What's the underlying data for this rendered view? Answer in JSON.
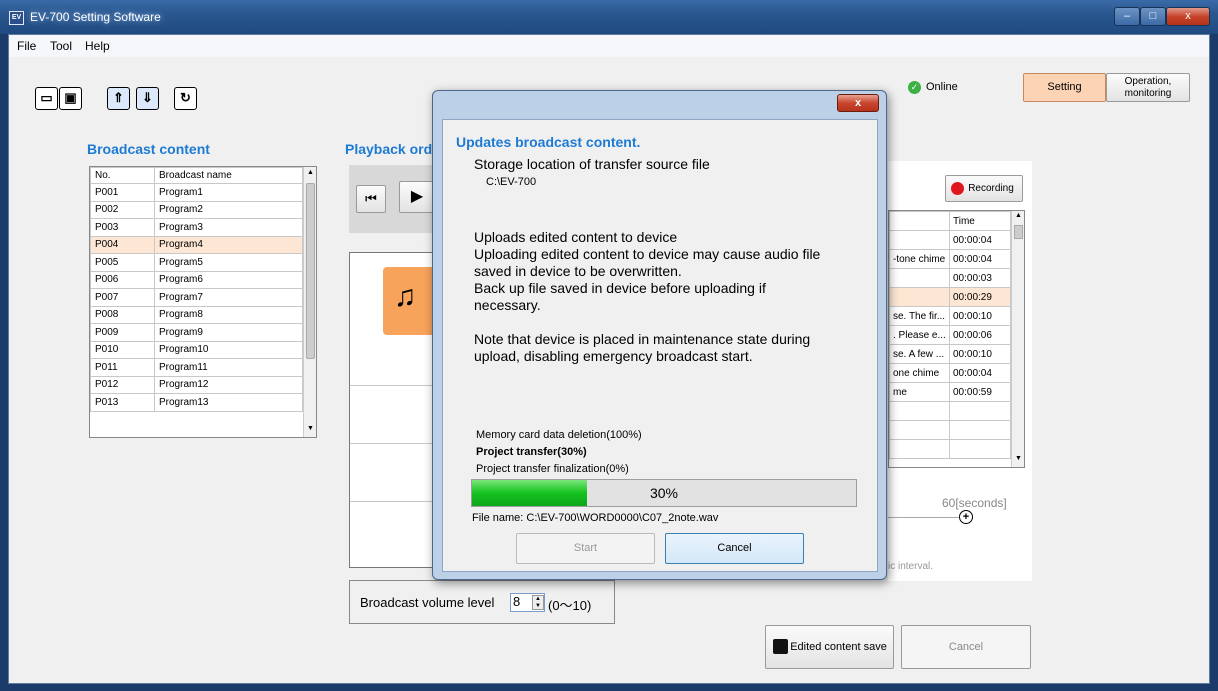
{
  "app": {
    "title": "EV-700 Setting Software",
    "icon_text": "EV"
  },
  "window_controls": {
    "min": "–",
    "max": "□",
    "close": "x"
  },
  "menu": [
    "File",
    "Tool",
    "Help"
  ],
  "toolbar": {
    "icons": [
      "open-icon",
      "save-icon",
      "upload-icon",
      "download-icon",
      "sync-icon"
    ]
  },
  "status": {
    "online_label": "Online",
    "online_color": "#3cb043"
  },
  "mode_buttons": {
    "setting": "Setting",
    "operation_line1": "Operation,",
    "operation_line2": "monitoring",
    "active_color": "#fcd3b4"
  },
  "broadcast_content": {
    "heading": "Broadcast content",
    "columns": [
      "No.",
      "Broadcast name"
    ],
    "rows": [
      [
        "P001",
        "Program1"
      ],
      [
        "P002",
        "Program2"
      ],
      [
        "P003",
        "Program3"
      ],
      [
        "P004",
        "Program4"
      ],
      [
        "P005",
        "Program5"
      ],
      [
        "P006",
        "Program6"
      ],
      [
        "P007",
        "Program7"
      ],
      [
        "P008",
        "Program8"
      ],
      [
        "P009",
        "Program9"
      ],
      [
        "P010",
        "Program10"
      ],
      [
        "P011",
        "Program11"
      ],
      [
        "P012",
        "Program12"
      ],
      [
        "P013",
        "Program13"
      ]
    ],
    "selected_index": 3
  },
  "playback": {
    "heading": "Playback ord",
    "prev_icon": "⏮",
    "play_icon": "▶",
    "note_icon": "♫"
  },
  "right_panel": {
    "recording_label": "Recording",
    "time_header": "Time",
    "rows": [
      [
        "",
        "00:00:04"
      ],
      [
        "-tone chime",
        "00:00:04"
      ],
      [
        "",
        "00:00:03"
      ],
      [
        "",
        "00:00:29"
      ],
      [
        "se. The fir...",
        "00:00:10"
      ],
      [
        ". Please e...",
        "00:00:06"
      ],
      [
        "se. A few ...",
        "00:00:10"
      ],
      [
        "one chime",
        "00:00:04"
      ],
      [
        "me",
        "00:00:59"
      ],
      [
        "",
        ""
      ],
      [
        "",
        ""
      ],
      [
        "",
        ""
      ]
    ],
    "selected_index": 3,
    "seconds_label": "60[seconds]",
    "interval_text": "ic interval."
  },
  "volume": {
    "label": "Broadcast volume level",
    "value": "8",
    "range": "(0〜10)"
  },
  "bottom_buttons": {
    "save": "Edited content save",
    "cancel": "Cancel"
  },
  "dialog": {
    "close": "x",
    "title": "Updates broadcast content.",
    "storage_label": "Storage location of transfer source file",
    "storage_path": "C:\\EV-700",
    "message_lines": [
      "Uploads edited content to device",
      "Uploading edited content to device may cause audio file",
      "saved in device to be overwritten.",
      "Back up file saved in device before uploading if",
      "necessary."
    ],
    "note_lines": [
      "Note that device is placed in maintenance state during",
      "upload, disabling emergency broadcast start."
    ],
    "steps": [
      "Memory card data deletion(100%)",
      "Project transfer(30%)",
      "Project transfer finalization(0%)"
    ],
    "progress": 0.3,
    "progress_text": "30%",
    "file_name": "File name: C:\\EV-700\\WORD0000\\C07_2note.wav",
    "start_label": "Start",
    "cancel_label": "Cancel"
  }
}
